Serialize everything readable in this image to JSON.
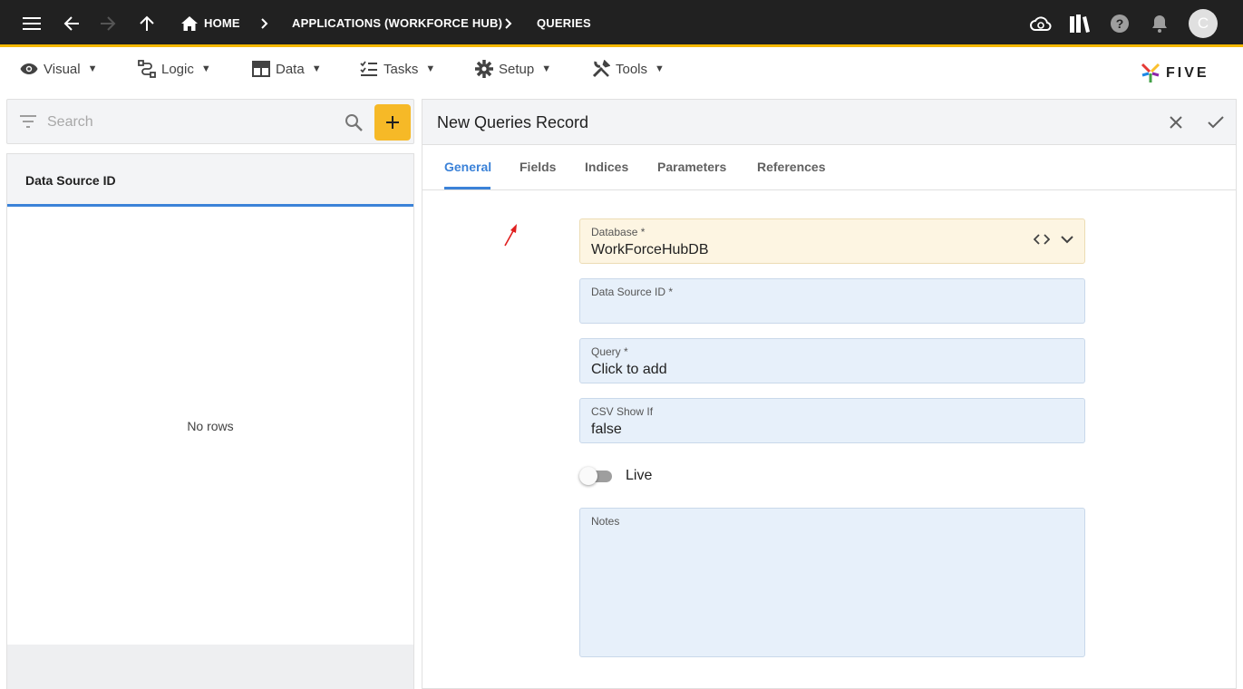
{
  "topbar": {
    "breadcrumbs": [
      "HOME",
      "APPLICATIONS (WORKFORCE HUB)",
      "QUERIES"
    ],
    "avatar_initial": "C",
    "accent_color": "#f5b800"
  },
  "menubar": {
    "items": [
      {
        "label": "Visual",
        "icon": "eye-icon"
      },
      {
        "label": "Logic",
        "icon": "logic-icon"
      },
      {
        "label": "Data",
        "icon": "table-icon"
      },
      {
        "label": "Tasks",
        "icon": "checklist-icon"
      },
      {
        "label": "Setup",
        "icon": "gear-icon"
      },
      {
        "label": "Tools",
        "icon": "tools-icon"
      }
    ],
    "caret": "▼",
    "brand": "FIVE"
  },
  "left_panel": {
    "search_placeholder": "Search",
    "column_header": "Data Source ID",
    "empty_text": "No rows",
    "add_button_color": "#f6b927"
  },
  "form": {
    "title": "New Queries Record",
    "tabs": [
      "General",
      "Fields",
      "Indices",
      "Parameters",
      "References"
    ],
    "active_tab": "General",
    "fields": {
      "database": {
        "label": "Database *",
        "value": "WorkForceHubDB"
      },
      "data_source_id": {
        "label": "Data Source ID *",
        "value": ""
      },
      "query": {
        "label": "Query *",
        "value": "Click to add"
      },
      "csv_show_if": {
        "label": "CSV Show If",
        "value": "false"
      },
      "live": {
        "label": "Live",
        "checked": false
      },
      "notes": {
        "label": "Notes",
        "value": ""
      }
    },
    "accent_color": "#3b82d8"
  }
}
